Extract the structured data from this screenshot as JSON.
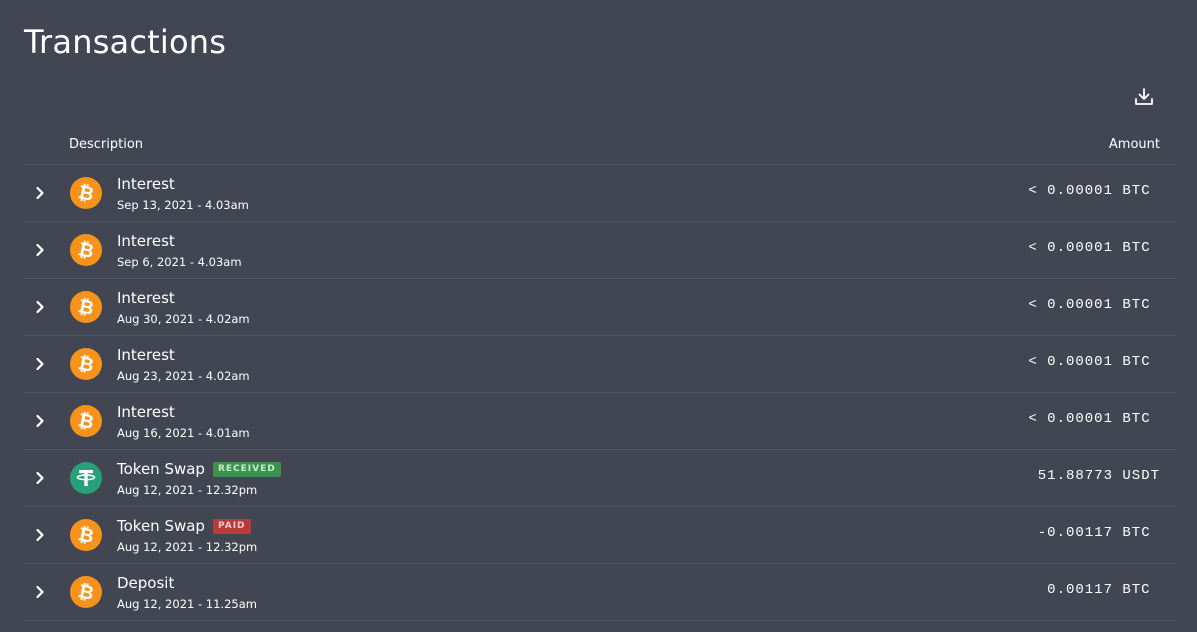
{
  "page": {
    "title": "Transactions"
  },
  "toolbar": {
    "download_icon": "download-icon"
  },
  "table": {
    "headers": {
      "description": "Description",
      "amount": "Amount"
    },
    "rows": [
      {
        "coin": "btc",
        "title": "Interest",
        "badge": "",
        "date": "Sep 13, 2021 - 4.03am",
        "amount": "< 0.00001 BTC "
      },
      {
        "coin": "btc",
        "title": "Interest",
        "badge": "",
        "date": "Sep 6, 2021 - 4.03am",
        "amount": "< 0.00001 BTC "
      },
      {
        "coin": "btc",
        "title": "Interest",
        "badge": "",
        "date": "Aug 30, 2021 - 4.02am",
        "amount": "< 0.00001 BTC "
      },
      {
        "coin": "btc",
        "title": "Interest",
        "badge": "",
        "date": "Aug 23, 2021 - 4.02am",
        "amount": "< 0.00001 BTC "
      },
      {
        "coin": "btc",
        "title": "Interest",
        "badge": "",
        "date": "Aug 16, 2021 - 4.01am",
        "amount": "< 0.00001 BTC "
      },
      {
        "coin": "usdt",
        "title": "Token Swap",
        "badge": "RECEIVED",
        "badge_type": "received",
        "date": "Aug 12, 2021 - 12.32pm",
        "amount": "51.88773 USDT"
      },
      {
        "coin": "btc",
        "title": "Token Swap",
        "badge": "PAID",
        "badge_type": "paid",
        "date": "Aug 12, 2021 - 12.32pm",
        "amount": "-0.00117 BTC "
      },
      {
        "coin": "btc",
        "title": "Deposit",
        "badge": "",
        "date": "Aug 12, 2021 - 11.25am",
        "amount": "0.00117 BTC "
      }
    ]
  },
  "colors": {
    "background": "#424653",
    "btc": "#f7931a",
    "usdt": "#26a17b",
    "received_badge": "#3f8f4d",
    "paid_badge": "#b63b3b",
    "divider": "#50545f"
  }
}
